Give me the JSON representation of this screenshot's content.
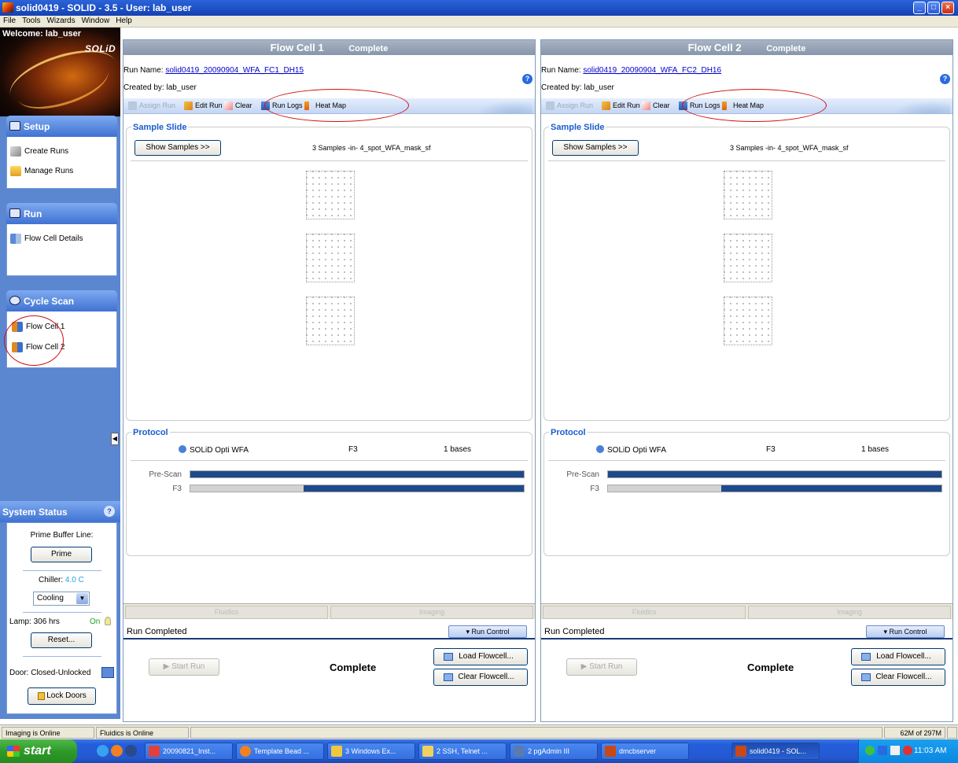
{
  "window": {
    "title": "solid0419 - SOLID - 3.5 - User: lab_user",
    "buttons": [
      "_",
      "□",
      "×"
    ]
  },
  "menu": [
    "File",
    "Tools",
    "Wizards",
    "Window",
    "Help"
  ],
  "sidebar": {
    "welcome": "Welcome:  lab_user",
    "brand": "SOLiD",
    "sections": [
      {
        "title": "Setup",
        "items": [
          "Create Runs",
          "Manage Runs"
        ]
      },
      {
        "title": "Run",
        "items": [
          "Flow Cell Details"
        ]
      },
      {
        "title": "Cycle Scan",
        "items": [
          "Flow Cell 1",
          "Flow Cell 2"
        ]
      }
    ],
    "collapse_glyph": "◀"
  },
  "system_status": {
    "title": "System Status",
    "help": "?",
    "prime_label": "Prime Buffer Line:",
    "prime_button": "Prime",
    "chiller_label": "Chiller:",
    "chiller_value": "4.0 C",
    "cooling_select": "Cooling",
    "lamp_label": "Lamp: 306 hrs",
    "lamp_state": "On",
    "reset_button": "Reset...",
    "door_label": "Door: Closed-Unlocked",
    "lock_button": "Lock Doors"
  },
  "flowcells": [
    {
      "name": "Flow Cell 1",
      "status": "Complete",
      "run_name_label": "Run Name:",
      "run_name": "solid0419_20090904_WFA_FC1_DH15",
      "created_by": "Created by: lab_user",
      "toolbar": [
        "Assign Run",
        "Edit Run",
        "Clear",
        "Run Logs",
        "Heat Map"
      ],
      "sample_slide_title": "Sample Slide",
      "show_samples": "Show Samples >>",
      "samples_text": "3 Samples -in- 4_spot_WFA_mask_sf",
      "protocol_title": "Protocol",
      "protocol_name": "SOLiD Opti WFA",
      "protocol_primer": "F3",
      "protocol_bases": "1 bases",
      "progress": [
        {
          "label": "Pre-Scan",
          "gray_fraction": 0.0
        },
        {
          "label": "F3",
          "gray_fraction": 0.34
        }
      ],
      "tabs": [
        "Fluidics",
        "Imaging"
      ],
      "run_completed": "Run Completed",
      "run_control": "▾ Run Control",
      "start_run": "▶ Start Run",
      "complete": "Complete",
      "load_flowcell": "Load Flowcell...",
      "clear_flowcell": "Clear Flowcell..."
    },
    {
      "name": "Flow Cell 2",
      "status": "Complete",
      "run_name_label": "Run Name:",
      "run_name": "solid0419_20090904_WFA_FC2_DH16",
      "created_by": "Created by: lab_user",
      "toolbar": [
        "Assign Run",
        "Edit Run",
        "Clear",
        "Run Logs",
        "Heat Map"
      ],
      "sample_slide_title": "Sample Slide",
      "show_samples": "Show Samples >>",
      "samples_text": "3 Samples -in- 4_spot_WFA_mask_sf",
      "protocol_title": "Protocol",
      "protocol_name": "SOLiD Opti WFA",
      "protocol_primer": "F3",
      "protocol_bases": "1 bases",
      "progress": [
        {
          "label": "Pre-Scan",
          "gray_fraction": 0.0
        },
        {
          "label": "F3",
          "gray_fraction": 0.34
        }
      ],
      "tabs": [
        "Fluidics",
        "Imaging"
      ],
      "run_completed": "Run Completed",
      "run_control": "▾ Run Control",
      "start_run": "▶ Start Run",
      "complete": "Complete",
      "load_flowcell": "Load Flowcell...",
      "clear_flowcell": "Clear Flowcell..."
    }
  ],
  "statusbar": {
    "imaging": "Imaging is Online",
    "fluidics": "Fluidics is Online",
    "memory": "62M of 297M"
  },
  "taskbar": {
    "start": "start",
    "tasks": [
      "20090821_Inst...",
      "Template Bead ...",
      "3 Windows Ex...",
      "2 SSH, Telnet ...",
      "2 pgAdmin III",
      "dmcbserver",
      "solid0419 - SOL..."
    ],
    "clock": "11:03 AM"
  },
  "colors": {
    "accent": "#1a5ccc",
    "progress": "#1e4a8c",
    "annotation_circle": "#d01010",
    "chiller": "#2aa0e0",
    "lamp_on": "#20a020"
  }
}
